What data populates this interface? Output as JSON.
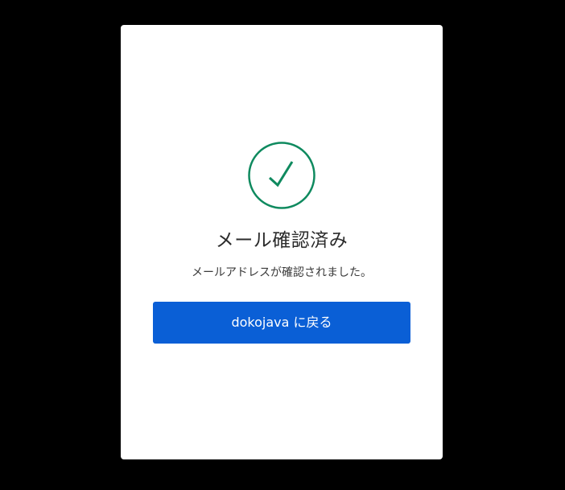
{
  "status": {
    "icon": "check-circle-icon",
    "icon_color": "#0f8a5f",
    "title": "メール確認済み",
    "message": "メールアドレスが確認されました。"
  },
  "actions": {
    "back_label": "dokojava に戻る",
    "button_color": "#0a5fd6"
  }
}
